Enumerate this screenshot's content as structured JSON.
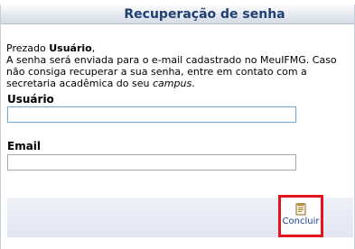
{
  "header": {
    "title": "Recuperação de senha"
  },
  "message": {
    "greeting_prefix": "Prezado ",
    "greeting_name": "Usuário",
    "greeting_suffix": ",",
    "body": "A senha será enviada para o e-mail cadastrado no MeuIFMG. Caso não consiga recuperar a sua senha, entre em contato com a secretaria acadêmica do seu ",
    "campus": "campus",
    "end": "."
  },
  "form": {
    "username_label": "Usuário",
    "username_value": "",
    "email_label": "Email",
    "email_value": ""
  },
  "footer": {
    "submit_label": "Concluir",
    "submit_icon": "document-check-icon",
    "highlight_color": "#e3141c"
  }
}
